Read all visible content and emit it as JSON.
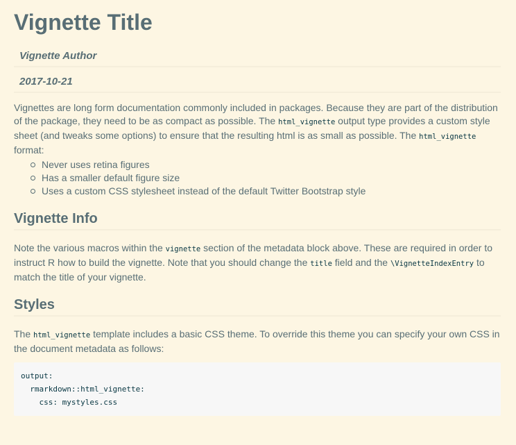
{
  "document": {
    "title": "Vignette Title",
    "author": "Vignette Author",
    "date": "2017-10-21"
  },
  "intro": {
    "text_1": "Vignettes are long form documentation commonly included in packages. Because they are part of the distribution of the package, they need to be as compact as possible. The ",
    "code_1": "html_vignette",
    "text_2": " output type provides a custom style sheet (and tweaks some options) to ensure that the resulting html is as small as possible. The ",
    "code_2": "html_vignette",
    "text_3": " format:",
    "bullets": [
      "Never uses retina figures",
      "Has a smaller default figure size",
      "Uses a custom CSS stylesheet instead of the default Twitter Bootstrap style"
    ]
  },
  "vignette_info": {
    "heading": "Vignette Info",
    "text_1": "Note the various macros within the ",
    "code_1": "vignette",
    "text_2": " section of the metadata block above. These are required in order to instruct R how to build the vignette. Note that you should change the ",
    "code_2": "title",
    "text_3": " field and the ",
    "code_3": "\\VignetteIndexEntry",
    "text_4": " to match the title of your vignette."
  },
  "styles": {
    "heading": "Styles",
    "text_1": "The ",
    "code_1": "html_vignette",
    "text_2": " template includes a basic CSS theme. To override this theme you can specify your own CSS in the document metadata as follows:",
    "code_block": [
      "output: ",
      "  rmarkdown::html_vignette:",
      "    css: mystyles.css"
    ]
  }
}
